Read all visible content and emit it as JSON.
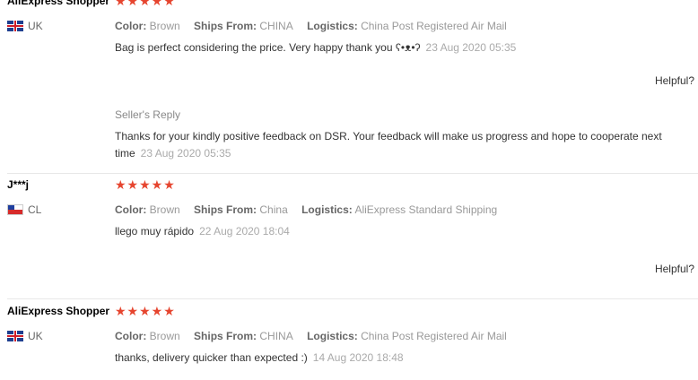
{
  "reviews": [
    {
      "name": "AliExpress Shopper",
      "stars": "★★★★★",
      "country": "UK",
      "color_label": "Color:",
      "color": "Brown",
      "ships_label": "Ships From:",
      "ships": "CHINA",
      "logistics_label": "Logistics:",
      "logistics": "China Post Registered Air Mail",
      "text": "Bag is perfect considering the price. Very happy thank you ʕ•ᴥ•ʔ",
      "date": "23 Aug 2020 05:35",
      "helpful": "Helpful?",
      "seller_reply_title": "Seller's Reply",
      "seller_reply_text": "Thanks for your kindly positive feedback on DSR. Your feedback will make us progress and hope to cooperate next time",
      "seller_reply_date": "23 Aug 2020 05:35"
    },
    {
      "name": "J***j",
      "stars": "★★★★★",
      "country": "CL",
      "color_label": "Color:",
      "color": "Brown",
      "ships_label": "Ships From:",
      "ships": "China",
      "logistics_label": "Logistics:",
      "logistics": "AliExpress Standard Shipping",
      "text": "llego muy rápido",
      "date": "22 Aug 2020 18:04",
      "helpful": "Helpful?"
    },
    {
      "name": "AliExpress Shopper",
      "stars": "★★★★★",
      "country": "UK",
      "color_label": "Color:",
      "color": "Brown",
      "ships_label": "Ships From:",
      "ships": "CHINA",
      "logistics_label": "Logistics:",
      "logistics": "China Post Registered Air Mail",
      "text": "thanks, delivery quicker than expected :)",
      "date": "14 Aug 2020 18:48"
    }
  ]
}
